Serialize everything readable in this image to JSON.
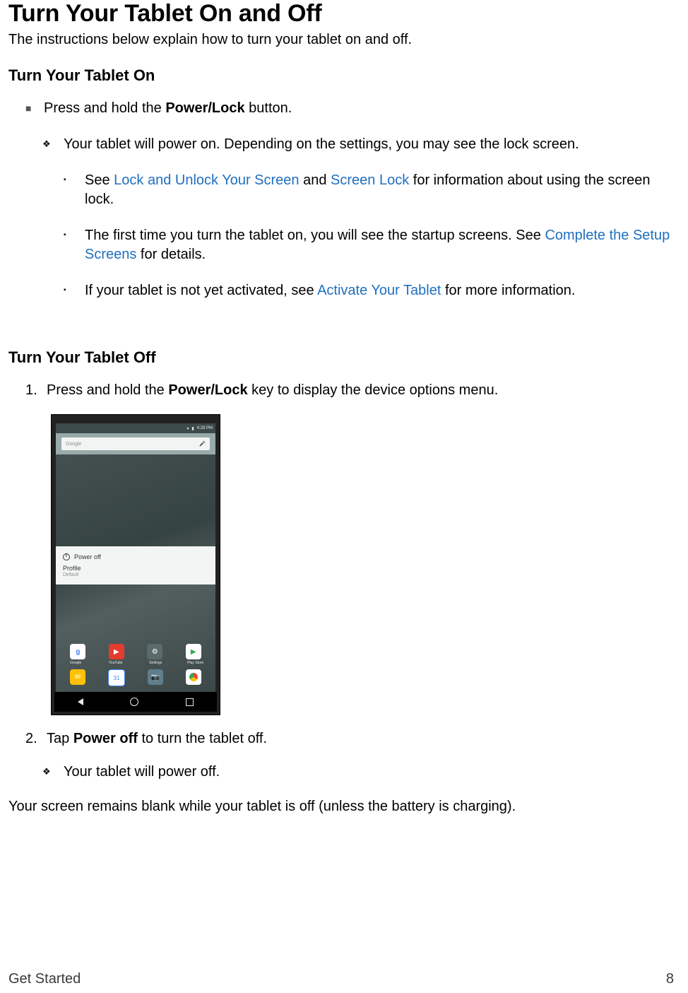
{
  "title": "Turn Your Tablet On and Off",
  "intro": "The instructions below explain how to turn your tablet on and off.",
  "section_on": {
    "heading": "Turn Your Tablet On",
    "bullet1_pre": "Press and hold the ",
    "bullet1_bold": "Power/Lock",
    "bullet1_post": " button.",
    "bullet1a": "Your tablet will power on. Depending on the settings, you may see the lock screen.",
    "bullet1a_i_pre": "See ",
    "bullet1a_i_link1": "Lock and Unlock Your Screen",
    "bullet1a_i_mid": " and ",
    "bullet1a_i_link2": "Screen Lock",
    "bullet1a_i_post": " for information about using the screen lock.",
    "bullet1a_ii_pre": "The first time you turn the tablet on, you will see the startup screens. See ",
    "bullet1a_ii_link": "Complete the Setup Screens",
    "bullet1a_ii_post": " for details.",
    "bullet1a_iii_pre": "If your tablet is not yet activated, see ",
    "bullet1a_iii_link": "Activate Your Tablet",
    "bullet1a_iii_post": " for more information."
  },
  "section_off": {
    "heading": "Turn Your Tablet Off",
    "step1_num": "1.",
    "step1_pre": "Press and hold the ",
    "step1_bold": "Power/Lock",
    "step1_post": " key to display the device options menu.",
    "step2_num": "2.",
    "step2_pre": "Tap ",
    "step2_bold": "Power off",
    "step2_post": " to turn the tablet off.",
    "step2a": "Your tablet will power off.",
    "closing": "Your screen remains blank while your tablet is off (unless the battery is charging)."
  },
  "tablet_mock": {
    "status_time": "4:28 PM",
    "search_left": "Google",
    "dialog_power": "Power off",
    "dialog_profile": "Profile",
    "dialog_profile_sub": "Default",
    "apps": {
      "a1": "Google",
      "a2": "YouTube",
      "a3": "Settings",
      "a4": "Play Store",
      "b1": "Email",
      "b2": "Calendar",
      "b3": "Camera",
      "b4": "Chrome"
    }
  },
  "footer": {
    "section": "Get Started",
    "page": "8"
  }
}
